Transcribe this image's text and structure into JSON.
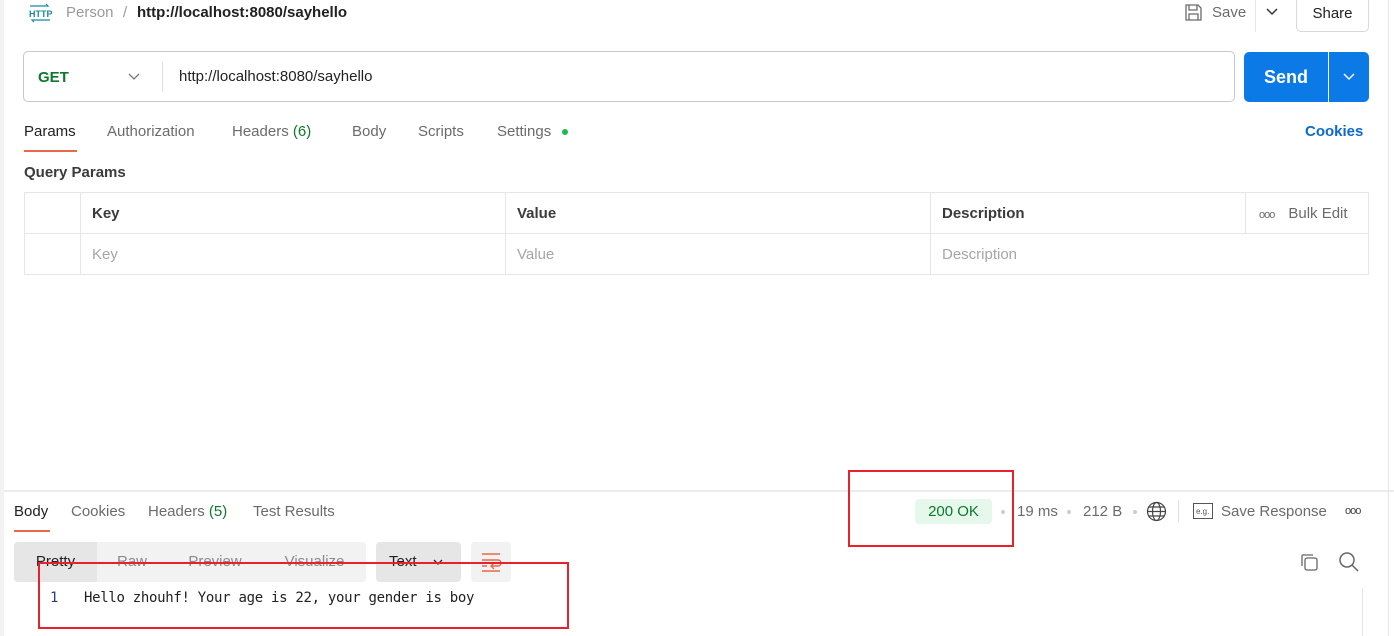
{
  "colors": {
    "accent": "#0b7ae6",
    "method": "#0b7a2b",
    "status_bg": "#e6f8ec",
    "status_fg": "#0b7a2b",
    "tab_underline": "#e9694a",
    "highlight": "#e8212a"
  },
  "breadcrumb": {
    "collection": "Person",
    "separator": "/",
    "request": "http://localhost:8080/sayhello"
  },
  "toolbar": {
    "save_label": "Save",
    "share_label": "Share"
  },
  "request": {
    "method": "GET",
    "url": "http://localhost:8080/sayhello",
    "send_label": "Send"
  },
  "request_tabs": [
    {
      "label": "Params"
    },
    {
      "label": "Authorization"
    },
    {
      "label": "Headers",
      "count": "(6)"
    },
    {
      "label": "Body"
    },
    {
      "label": "Scripts"
    },
    {
      "label": "Settings"
    }
  ],
  "cookies_label": "Cookies",
  "query_params": {
    "title": "Query Params",
    "headers": [
      "Key",
      "Value",
      "Description"
    ],
    "bulk_edit": "Bulk Edit",
    "placeholders": [
      "Key",
      "Value",
      "Description"
    ]
  },
  "response_tabs": [
    {
      "label": "Body"
    },
    {
      "label": "Cookies"
    },
    {
      "label": "Headers",
      "count": "(5)"
    },
    {
      "label": "Test Results"
    }
  ],
  "response_meta": {
    "status": "200 OK",
    "time": "19 ms",
    "size": "212 B",
    "save_response": "Save Response"
  },
  "view_modes": [
    "Pretty",
    "Raw",
    "Preview",
    "Visualize"
  ],
  "format": "Text",
  "response_body": [
    {
      "line": "1",
      "text": "Hello zhouhf! Your age is 22, your gender is boy"
    }
  ]
}
